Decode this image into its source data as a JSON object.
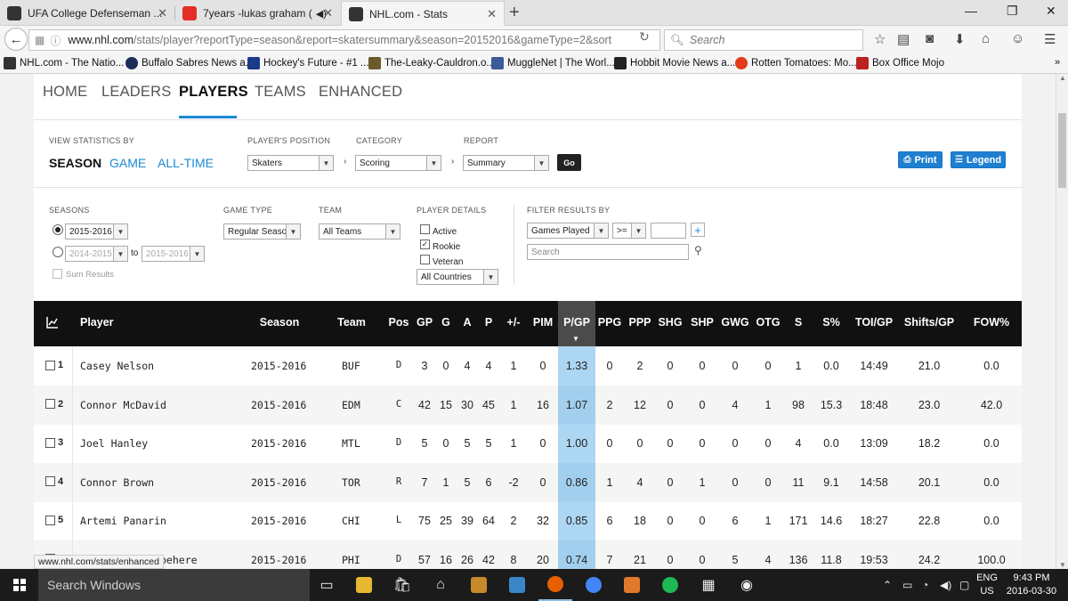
{
  "browser": {
    "tabs": [
      {
        "title": "UFA College Defenseman ...",
        "active": false,
        "icon": "nhl-icon"
      },
      {
        "title": "7years -lukas graham (",
        "active": false,
        "icon": "youtube-icon"
      },
      {
        "title": "NHL.com - Stats",
        "active": true,
        "icon": "nhl-icon"
      }
    ],
    "url_host": "www.nhl.com",
    "url_path": "/stats/player?reportType=season&report=skatersummary&season=20152016&gameType=2&sort",
    "search_placeholder": "Search",
    "bookmarks": [
      "NHL.com - The Natio...",
      "Buffalo Sabres News a...",
      "Hockey's Future - #1 ...",
      "The-Leaky-Cauldron.o...",
      "MuggleNet | The Worl...",
      "Hobbit Movie News a...",
      "Rotten Tomatoes: Mo...",
      "Box Office Mojo"
    ],
    "status_url": "www.nhl.com/stats/enhanced"
  },
  "site_nav": [
    "HOME",
    "LEADERS",
    "PLAYERS",
    "TEAMS",
    "ENHANCED"
  ],
  "controls": {
    "view_stats_label": "VIEW STATISTICS BY",
    "view_options": [
      "SEASON",
      "GAME",
      "ALL-TIME"
    ],
    "position_label": "PLAYER'S POSITION",
    "position_value": "Skaters",
    "category_label": "CATEGORY",
    "category_value": "Scoring",
    "report_label": "REPORT",
    "report_value": "Summary",
    "go_label": "Go",
    "print_label": "Print",
    "legend_label": "Legend"
  },
  "filters": {
    "seasons_label": "SEASONS",
    "season_single": "2015-2016",
    "season_from": "2014-2015",
    "season_to": "2015-2016",
    "to_label": "to",
    "sum_results": "Sum Results",
    "game_type_label": "GAME TYPE",
    "game_type_value": "Regular Season",
    "team_label": "TEAM",
    "team_value": "All Teams",
    "player_details_label": "PLAYER DETAILS",
    "active_label": "Active",
    "rookie_label": "Rookie",
    "veteran_label": "Veteran",
    "country_value": "All Countries",
    "filter_by_label": "FILTER RESULTS BY",
    "filter_field": "Games Played",
    "filter_op": ">=",
    "filter_value": "",
    "search_placeholder": "Search"
  },
  "table": {
    "headers": [
      "Player",
      "Season",
      "Team",
      "Pos",
      "GP",
      "G",
      "A",
      "P",
      "+/-",
      "PIM",
      "P/GP",
      "PPG",
      "PPP",
      "SHG",
      "SHP",
      "GWG",
      "OTG",
      "S",
      "S%",
      "TOI/GP",
      "Shifts/GP",
      "FOW%"
    ],
    "rows": [
      {
        "rank": "1",
        "cells": [
          "Casey Nelson",
          "2015-2016",
          "BUF",
          "D",
          "3",
          "0",
          "4",
          "4",
          "1",
          "0",
          "1.33",
          "0",
          "2",
          "0",
          "0",
          "0",
          "0",
          "1",
          "0.0",
          "14:49",
          "21.0",
          "0.0"
        ]
      },
      {
        "rank": "2",
        "cells": [
          "Connor McDavid",
          "2015-2016",
          "EDM",
          "C",
          "42",
          "15",
          "30",
          "45",
          "1",
          "16",
          "1.07",
          "2",
          "12",
          "0",
          "0",
          "4",
          "1",
          "98",
          "15.3",
          "18:48",
          "23.0",
          "42.0"
        ]
      },
      {
        "rank": "3",
        "cells": [
          "Joel Hanley",
          "2015-2016",
          "MTL",
          "D",
          "5",
          "0",
          "5",
          "5",
          "1",
          "0",
          "1.00",
          "0",
          "0",
          "0",
          "0",
          "0",
          "0",
          "4",
          "0.0",
          "13:09",
          "18.2",
          "0.0"
        ]
      },
      {
        "rank": "4",
        "cells": [
          "Connor Brown",
          "2015-2016",
          "TOR",
          "R",
          "7",
          "1",
          "5",
          "6",
          "-2",
          "0",
          "0.86",
          "1",
          "4",
          "0",
          "1",
          "0",
          "0",
          "11",
          "9.1",
          "14:58",
          "20.1",
          "0.0"
        ]
      },
      {
        "rank": "5",
        "cells": [
          "Artemi Panarin",
          "2015-2016",
          "CHI",
          "L",
          "75",
          "25",
          "39",
          "64",
          "2",
          "32",
          "0.85",
          "6",
          "18",
          "0",
          "0",
          "6",
          "1",
          "171",
          "14.6",
          "18:27",
          "22.8",
          "0.0"
        ]
      },
      {
        "rank": "6",
        "cells": [
          "Shayne Gostisbehere",
          "2015-2016",
          "PHI",
          "D",
          "57",
          "16",
          "26",
          "42",
          "8",
          "20",
          "0.74",
          "7",
          "21",
          "0",
          "0",
          "5",
          "4",
          "136",
          "11.8",
          "19:53",
          "24.2",
          "100.0"
        ]
      }
    ]
  },
  "taskbar": {
    "search_text": "Search Windows",
    "lang_line1": "ENG",
    "lang_line2": "US",
    "time": "9:43 PM",
    "date": "2016-03-30"
  },
  "colors": {
    "accent": "#1a8ad4",
    "sort_column": "#add6f3",
    "table_header": "#111111"
  }
}
